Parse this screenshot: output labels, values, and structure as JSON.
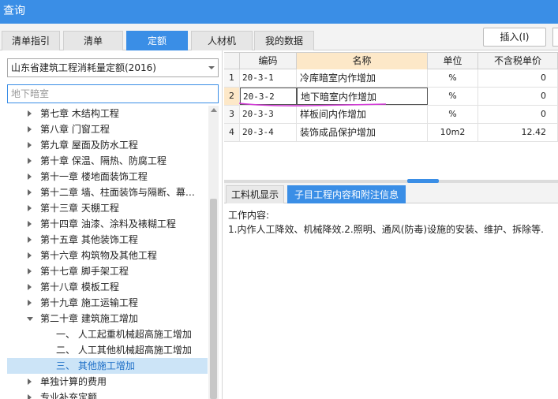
{
  "window": {
    "title": "查询"
  },
  "tabs": [
    {
      "label": "清单指引"
    },
    {
      "label": "清单"
    },
    {
      "label": "定额",
      "active": true
    },
    {
      "label": "人材机"
    },
    {
      "label": "我的数据"
    }
  ],
  "toolbar": {
    "insert_label": "插入(I)"
  },
  "left": {
    "library_select": "山东省建筑工程消耗量定额(2016)",
    "search_value": "地下暗室",
    "tree": [
      {
        "label": "第七章  木结构工程"
      },
      {
        "label": "第八章  门窗工程"
      },
      {
        "label": "第九章  屋面及防水工程"
      },
      {
        "label": "第十章  保温、隔热、防腐工程"
      },
      {
        "label": "第十一章  楼地面装饰工程"
      },
      {
        "label": "第十二章  墙、柱面装饰与隔断、幕…"
      },
      {
        "label": "第十三章  天棚工程"
      },
      {
        "label": "第十四章  油漆、涂料及裱糊工程"
      },
      {
        "label": "第十五章  其他装饰工程"
      },
      {
        "label": "第十六章  构筑物及其他工程"
      },
      {
        "label": "第十七章  脚手架工程"
      },
      {
        "label": "第十八章  模板工程"
      },
      {
        "label": "第十九章  施工运输工程"
      },
      {
        "label": "第二十章  建筑施工增加"
      },
      {
        "label": "一、  人工起重机械超高施工增加"
      },
      {
        "label": "二、  人工其他机械超高施工增加"
      },
      {
        "label": "三、  其他施工增加"
      },
      {
        "label": "单独计算的费用"
      },
      {
        "label": "专业补充定额"
      }
    ]
  },
  "table": {
    "headers": {
      "code": "编码",
      "name": "名称",
      "unit": "单位",
      "price": "不含税单价"
    },
    "rows": [
      {
        "idx": "1",
        "code": "20-3-1",
        "name": "冷库暗室内作增加",
        "unit": "%",
        "price": "0"
      },
      {
        "idx": "2",
        "code": "20-3-2",
        "name": "地下暗室内作增加",
        "unit": "%",
        "price": "0"
      },
      {
        "idx": "3",
        "code": "20-3-3",
        "name": "样板间内作增加",
        "unit": "%",
        "price": "0"
      },
      {
        "idx": "4",
        "code": "20-3-4",
        "name": "装饰成品保护增加",
        "unit": "10m2",
        "price": "12.42"
      }
    ]
  },
  "bottom": {
    "tabs": [
      {
        "label": "工料机显示"
      },
      {
        "label": "子目工程内容和附注信息"
      }
    ],
    "content_title": "工作内容:",
    "content_text": "1.内作人工降效、机械降效.2.照明、通风(防毒)设施的安装、维护、拆除等."
  },
  "colors": {
    "accent": "#3a8ee6",
    "annotation": "#d43bd8"
  }
}
